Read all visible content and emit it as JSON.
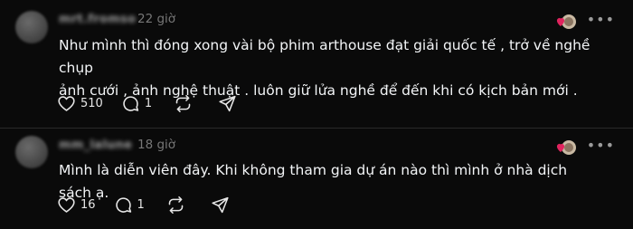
{
  "comments": [
    {
      "username": "mrt.fromso",
      "time": "22 giờ",
      "text_line1": "Như mình thì đóng xong vài bộ phim arthouse đạt giải quốc tế , trở về nghề chụp",
      "text_line2": "ảnh cưới , ảnh nghệ thuật . luôn giữ lửa nghề để đến khi có kịch bản mới .",
      "likes": "510",
      "replies": "1"
    },
    {
      "username": "mm_lalune",
      "time": "18 giờ",
      "text_line1": "Mình là diễn viên đây. Khi không tham gia dự án nào thì mình ở nhà dịch sách ạ.",
      "likes": "16",
      "replies": "1"
    }
  ],
  "icons": {
    "like": "heart-icon",
    "reply": "comment-icon",
    "repost": "repost-icon",
    "share": "send-icon",
    "more": "more-icon"
  },
  "colors": {
    "background": "#0a0a0a",
    "text": "#f3f5f7",
    "muted": "#777777",
    "heart_badge": "#e0245e"
  }
}
